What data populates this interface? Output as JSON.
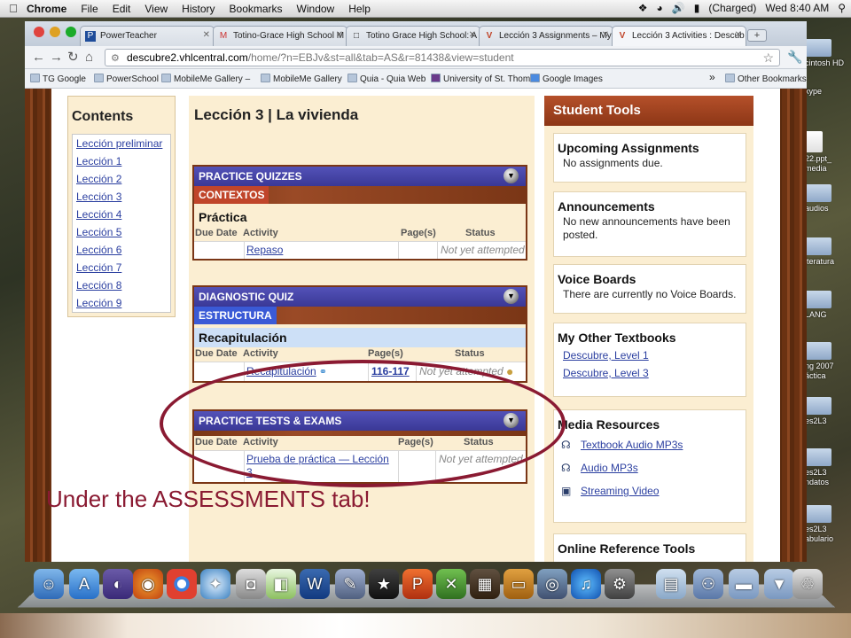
{
  "menubar": {
    "app": "Chrome",
    "items": [
      "File",
      "Edit",
      "View",
      "History",
      "Bookmarks",
      "Window",
      "Help"
    ],
    "battery": "(Charged)",
    "clock": "Wed 8:40 AM"
  },
  "desktop_icons": [
    "cintosh HD",
    "kype",
    "22.ppt_ media",
    "audios",
    "iteratura",
    "LANG",
    "ng 2007 áctica",
    "es2L3",
    "es2L3 ndatos",
    "es2L3 abulario"
  ],
  "tabs": [
    {
      "label": "PowerTeacher",
      "fav": "P"
    },
    {
      "label": "Totino-Grace High School M",
      "fav": "M"
    },
    {
      "label": "Totino Grace High School: A",
      "fav": "□"
    },
    {
      "label": "Lección 3 Assignments – My",
      "fav": "V"
    },
    {
      "label": "Lección 3 Activities : Descub",
      "fav": "V"
    }
  ],
  "url": {
    "host": "descubre2.vhlcentral.com",
    "path": "/home/?n=EBJv&st=all&tab=AS&r=81438&view=student"
  },
  "bookmarks": [
    "TG Google",
    "PowerSchool",
    "MobileMe Gallery – ",
    "MobileMe Gallery",
    "Quia - Quia Web",
    "University of St. Thom",
    "Google Images"
  ],
  "bookmarks_more": "»",
  "other_bookmarks": "Other Bookmarks",
  "contents": {
    "title": "Contents",
    "items": [
      "Lección preliminar",
      "Lección 1",
      "Lección 2",
      "Lección 3",
      "Lección 4",
      "Lección 5",
      "Lección 6",
      "Lección 7",
      "Lección 8",
      "Lección 9"
    ]
  },
  "main": {
    "title": "Lección 3 | La vivienda",
    "columns": {
      "due": "Due Date",
      "activity": "Activity",
      "pages": "Page(s)",
      "status": "Status"
    },
    "panels": [
      {
        "header": "PRACTICE QUIZZES",
        "category": "CONTEXTOS",
        "section": "Práctica",
        "activity": "Repaso",
        "pages": "",
        "status": "Not yet attempted"
      },
      {
        "header": "DIAGNOSTIC QUIZ",
        "category": "ESTRUCTURA",
        "section": "Recapitulación",
        "activity": "Recapitulación",
        "pages": "116-117",
        "status": "Not yet attempted"
      },
      {
        "header": "PRACTICE TESTS & EXAMS",
        "activity": "Prueba de práctica — Lección 3",
        "pages": "",
        "status": "Not yet attempted"
      }
    ]
  },
  "annotation": "Under the ASSESSMENTS tab!",
  "tools": {
    "title": "Student Tools",
    "upcoming": {
      "title": "Upcoming Assignments",
      "text": "No assignments due."
    },
    "announcements": {
      "title": "Announcements",
      "text": "No new announcements have been posted."
    },
    "voice": {
      "title": "Voice Boards",
      "text": "There are currently no Voice Boards."
    },
    "textbooks": {
      "title": "My Other Textbooks",
      "links": [
        "Descubre, Level 1",
        "Descubre, Level 3"
      ]
    },
    "media": {
      "title": "Media Resources",
      "links": [
        "Textbook Audio MP3s",
        "Audio MP3s",
        "Streaming Video"
      ]
    },
    "reference": {
      "title": "Online Reference Tools"
    }
  },
  "colors": {
    "panel_header": "#3a3896",
    "brown": "#7a3616",
    "link": "#2b3fa0",
    "annotation": "#8a1a32"
  }
}
